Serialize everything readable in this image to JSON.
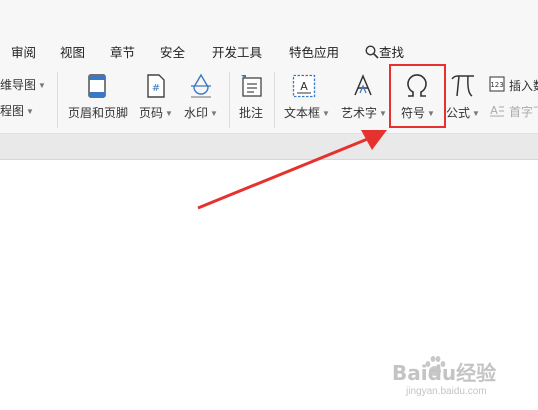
{
  "menu": {
    "items": [
      "审阅",
      "视图",
      "章节",
      "安全",
      "开发工具",
      "特色应用"
    ],
    "search_label": "查找"
  },
  "ribbon": {
    "mindmap_label": "思维导图",
    "flowchart_label": "流程图",
    "header_footer_label": "页眉和页脚",
    "page_number_label": "页码",
    "watermark_label": "水印",
    "comment_label": "批注",
    "textbox_label": "文本框",
    "wordart_label": "艺术字",
    "symbol_label": "符号",
    "formula_label": "公式",
    "insert_number_label": "插入数",
    "dropcap_label": "首字下"
  },
  "watermark": {
    "brand": "Baidu经验",
    "url": "jingyan.baidu.com"
  },
  "colors": {
    "highlight": "#e6322e",
    "arrow": "#e6322e",
    "accent_icon": "#3a78c3"
  }
}
